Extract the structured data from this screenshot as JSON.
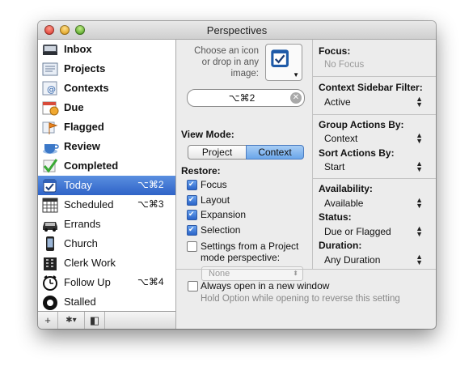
{
  "window": {
    "title": "Perspectives"
  },
  "sidebar": {
    "items": [
      {
        "label": "Inbox",
        "bold": true,
        "shortcut": "",
        "icon": "inbox-tray-icon"
      },
      {
        "label": "Projects",
        "bold": true,
        "shortcut": "",
        "icon": "projects-folder-icon"
      },
      {
        "label": "Contexts",
        "bold": true,
        "shortcut": "",
        "icon": "contexts-at-icon"
      },
      {
        "label": "Due",
        "bold": true,
        "shortcut": "",
        "icon": "due-calendar-icon"
      },
      {
        "label": "Flagged",
        "bold": true,
        "shortcut": "",
        "icon": "flag-icon"
      },
      {
        "label": "Review",
        "bold": true,
        "shortcut": "",
        "icon": "review-cup-icon"
      },
      {
        "label": "Completed",
        "bold": true,
        "shortcut": "",
        "icon": "checkmark-icon"
      },
      {
        "label": "Today",
        "bold": false,
        "shortcut": "⌥⌘2",
        "icon": "today-check-icon",
        "selected": true
      },
      {
        "label": "Scheduled",
        "bold": false,
        "shortcut": "⌥⌘3",
        "icon": "calendar-grid-icon"
      },
      {
        "label": "Errands",
        "bold": false,
        "shortcut": "",
        "icon": "car-icon"
      },
      {
        "label": "Church",
        "bold": false,
        "shortcut": "",
        "icon": "phone-icon"
      },
      {
        "label": "Clerk Work",
        "bold": false,
        "shortcut": "",
        "icon": "building-icon"
      },
      {
        "label": "Follow Up",
        "bold": false,
        "shortcut": "⌥⌘4",
        "icon": "clock-icon"
      },
      {
        "label": "Stalled",
        "bold": false,
        "shortcut": "",
        "icon": "stalled-icon"
      }
    ],
    "bottom": {
      "add": "+",
      "gear": "✱▾",
      "toggle": "◧"
    }
  },
  "icon_panel": {
    "hint": "Choose an icon or drop in any image:"
  },
  "shortcut_field": {
    "value": "⌥⌘2"
  },
  "view_mode": {
    "label": "View Mode:",
    "options": [
      "Project",
      "Context"
    ],
    "selected": "Context"
  },
  "restore": {
    "label": "Restore:",
    "focus": "Focus",
    "layout": "Layout",
    "expansion": "Expansion",
    "selection": "Selection",
    "settings_from": "Settings from a Project mode perspective:",
    "none_option": "None"
  },
  "right_panel": {
    "focus_label": "Focus:",
    "focus_value": "No Focus",
    "context_filter_label": "Context Sidebar Filter:",
    "context_filter_value": "Active",
    "group_by_label": "Group Actions By:",
    "group_by_value": "Context",
    "sort_by_label": "Sort Actions By:",
    "sort_by_value": "Start",
    "availability_label": "Availability:",
    "availability_value": "Available",
    "status_label": "Status:",
    "status_value": "Due or Flagged",
    "duration_label": "Duration:",
    "duration_value": "Any Duration"
  },
  "footer": {
    "always_open": "Always open in a new window",
    "hint": "Hold Option while opening to reverse this setting"
  },
  "colors": {
    "selection": "#2f63c7",
    "accent": "#5a8fe0"
  }
}
